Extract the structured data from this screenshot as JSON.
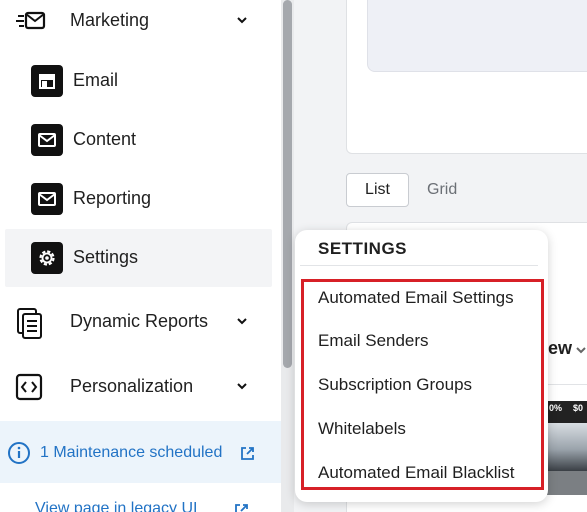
{
  "sidebar": {
    "marketing": {
      "label": "Marketing"
    },
    "sub_items": [
      {
        "label": "Email"
      },
      {
        "label": "Content"
      },
      {
        "label": "Reporting"
      },
      {
        "label": "Settings"
      }
    ],
    "dynamic_reports": {
      "label": "Dynamic Reports"
    },
    "personalization": {
      "label": "Personalization"
    },
    "maintenance": {
      "text": "1 Maintenance scheduled"
    },
    "legacy_link": {
      "text": "View page in legacy UI"
    }
  },
  "main": {
    "view_toggle": {
      "list": "List",
      "grid": "Grid"
    },
    "thumbnail": {
      "tag1": "0%",
      "tag2": "$0"
    }
  },
  "popover": {
    "title": "SETTINGS",
    "items": [
      {
        "label": "Automated Email Settings"
      },
      {
        "label": "Email Senders"
      },
      {
        "label": "Subscription Groups"
      },
      {
        "label": "Whitelabels"
      },
      {
        "label": "Automated Email Blacklist"
      }
    ]
  },
  "colors": {
    "highlight": "#d72027",
    "link": "#2273c5",
    "banner_bg": "#ecf4fb"
  }
}
